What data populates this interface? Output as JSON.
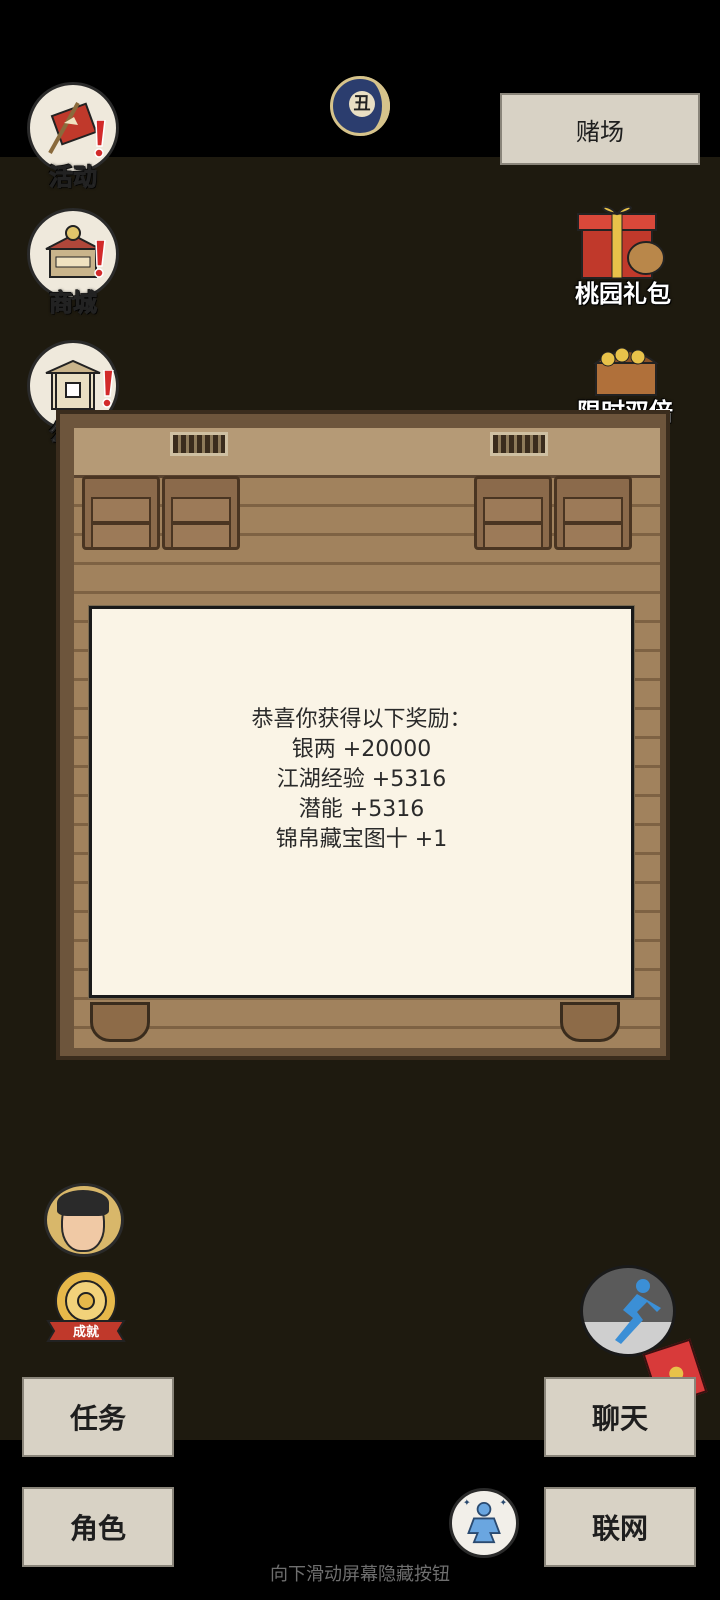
{
  "top_bar": {
    "time_char": "丑",
    "casino_label": "赌场"
  },
  "left_menu": [
    {
      "label": "活动"
    },
    {
      "label": "商城"
    },
    {
      "label": "公告"
    }
  ],
  "right_menu": {
    "gift_label": "桃园礼包",
    "double_label": "限时双倍"
  },
  "dialog": {
    "lines": [
      "恭喜你获得以下奖励：",
      "银两 +20000",
      "江湖经验 +5316",
      "潜能 +5316",
      "锦帛藏宝图十 +1"
    ]
  },
  "bottom": {
    "achievement_label": "成就",
    "task_label": "任务",
    "role_label": "角色",
    "chat_label": "聊天",
    "online_label": "联网",
    "hint": "向下滑动屏幕隐藏按钮"
  },
  "colors": {
    "background": "#1e1a0f",
    "button_bg": "#d8d2c5",
    "dialog_bg": "#faf4e6",
    "alert_red": "#d22a2a"
  },
  "icons": [
    "scroll-flag-icon",
    "shop-icon",
    "notice-gate-icon",
    "gift-box-icon",
    "treasure-chest-icon",
    "runner-icon",
    "red-envelope-icon",
    "meditate-icon",
    "achievement-medal-icon"
  ]
}
